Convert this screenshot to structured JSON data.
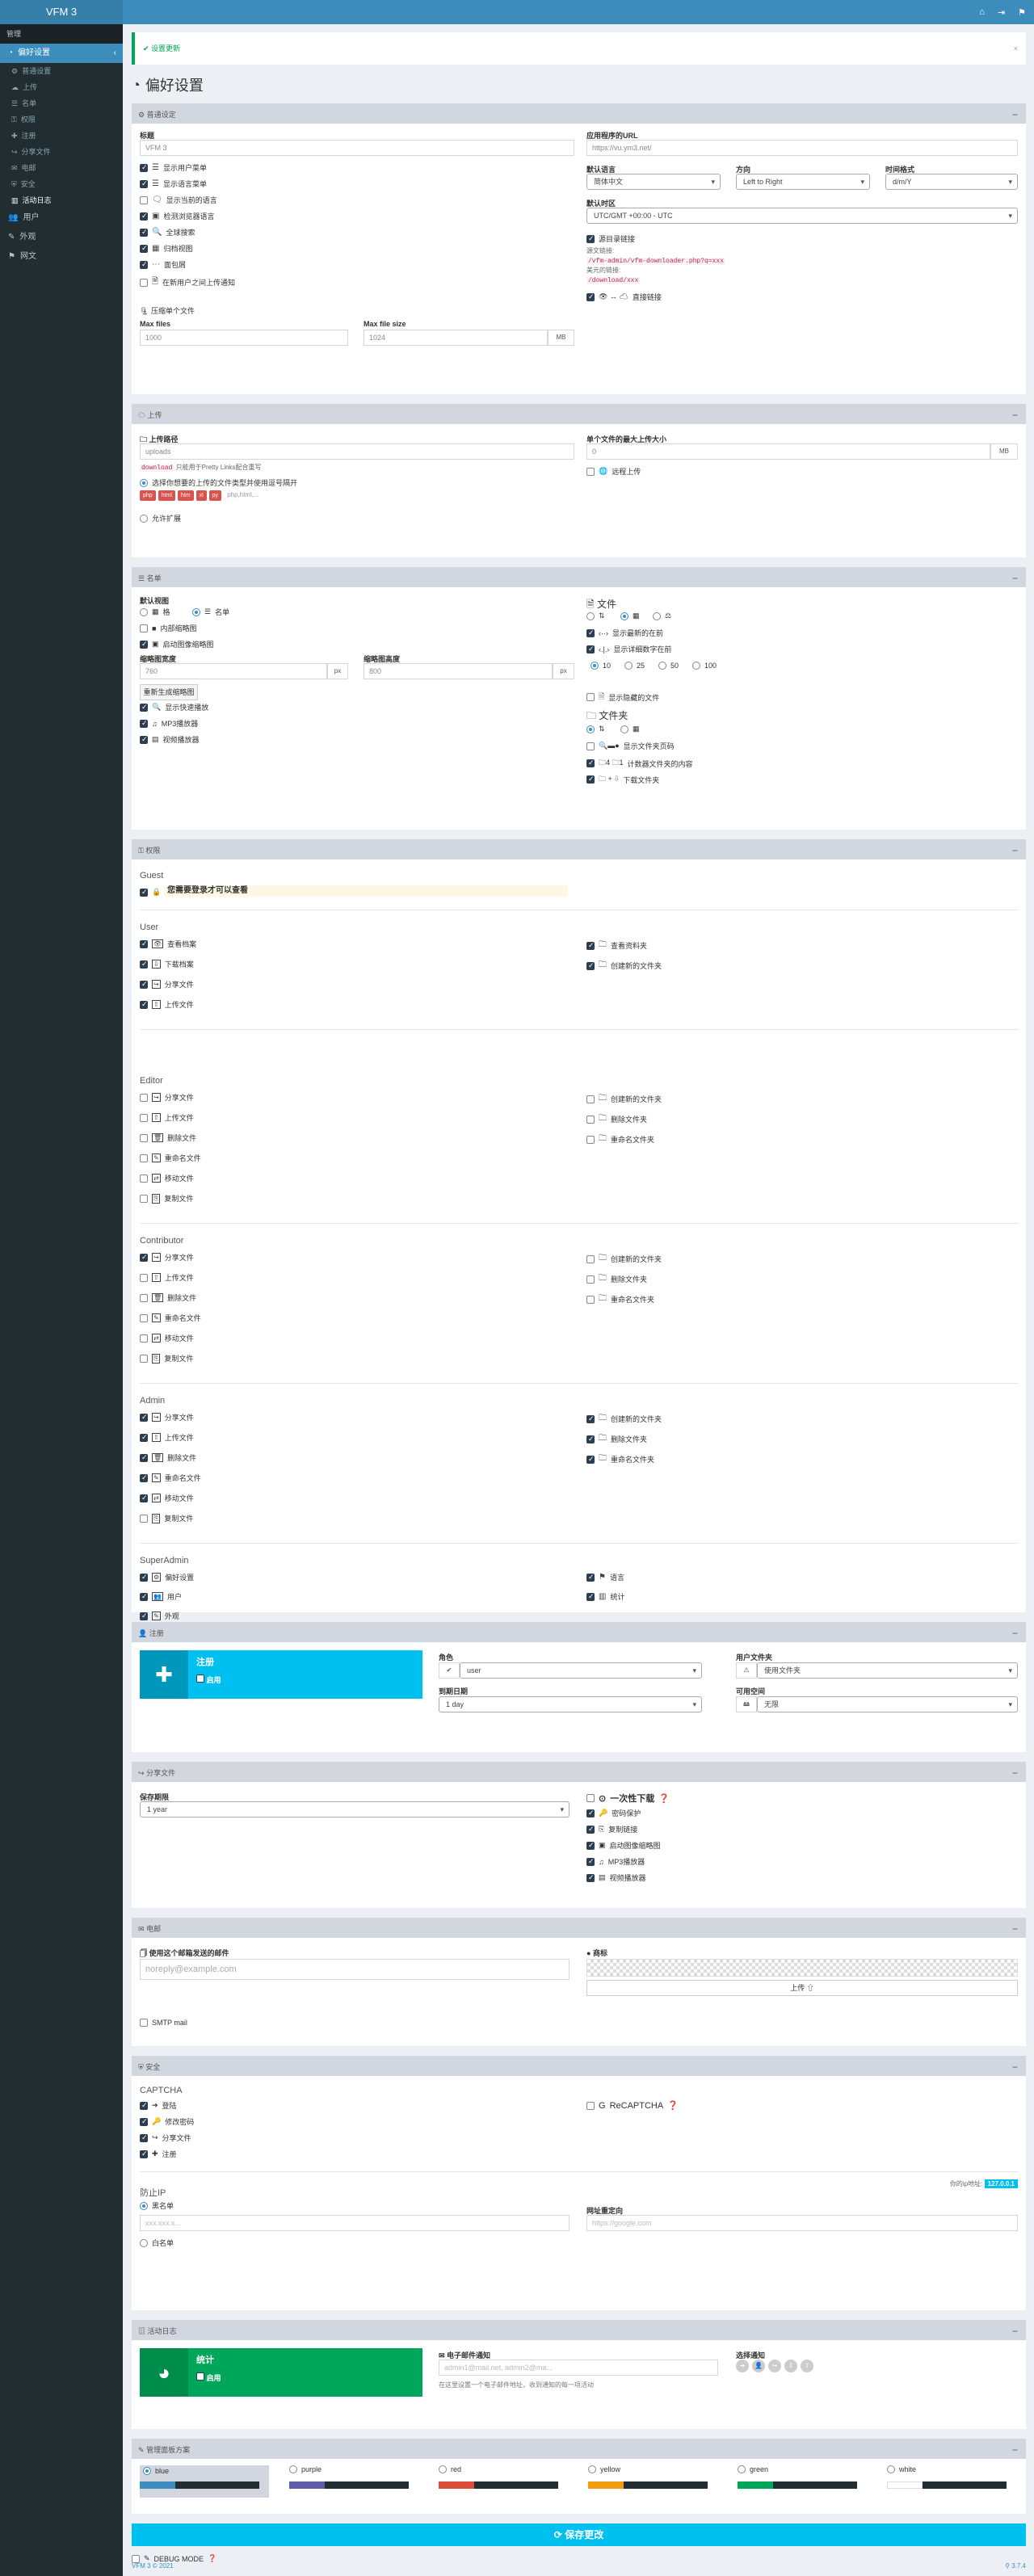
{
  "app": {
    "logo": "VFM 3",
    "footer": "VFM 3 © 2021",
    "version": "3.7.4",
    "topicons": [
      "⌂",
      "⇥",
      "⚑"
    ]
  },
  "sidebar": {
    "head": "管理",
    "active": "偏好设置",
    "subs": [
      "普通设置",
      "上传",
      "名单",
      "权限",
      "注册",
      "分享文件",
      "电邮",
      "安全",
      "活动日志"
    ],
    "items": [
      "用户",
      "外观",
      "网文"
    ]
  },
  "alert": "设置更新",
  "title": "偏好设置",
  "general": {
    "header": "普通设定",
    "title_label": "标题",
    "title_value": "VFM 3",
    "url_label": "应用程序的URL",
    "url_value": "https://vu.ym3.net/",
    "checks": [
      {
        "t": "显示用户菜单",
        "on": true
      },
      {
        "t": "显示语言菜单",
        "on": true
      },
      {
        "t": "显示当前的语言",
        "on": false
      },
      {
        "t": "检测浏览器语言",
        "on": true
      },
      {
        "t": "全球搜索",
        "on": true
      },
      {
        "t": "归档视图",
        "on": true
      },
      {
        "t": "面包屑",
        "on": true
      },
      {
        "t": "在新用户之间上传通知",
        "on": false
      }
    ],
    "single_file": "压缩单个文件",
    "max_files_label": "Max files",
    "max_files": "1000",
    "max_size_label": "Max file size",
    "max_size": "1024",
    "mb": "MB",
    "lang_label": "默认语言",
    "lang": "简体中文",
    "dir_label": "方向",
    "dir": "Left to Right",
    "time_label": "时间格式",
    "time": "d/m/Y",
    "tz_label": "默认时区",
    "tz": "UTC/GMT +00:00 - UTC",
    "direct_label": "源目录链接",
    "direct_on": true,
    "dl_text1": "源文链接:",
    "dl_code1": "/vfm-admin/vfm-downloader.php?q=xxx",
    "dl_text2": "美元的链接:",
    "dl_code2": "/download/xxx",
    "direct2": "直接链接"
  },
  "upload": {
    "header": "上传",
    "dir_label": "上传路径",
    "dir_value": "uploads",
    "prettylink_code": "download",
    "prettylink_text": "只能用于Pretty Links配合重写",
    "max_label": "单个文件的最大上传大小",
    "max_value": "0",
    "mb": "MB",
    "allowed": "选择你想要的上传的文件类型并使用逗号隔开",
    "types": [
      "php",
      "html",
      "htm",
      "xl",
      "py"
    ],
    "types_more": "php,html,...",
    "remote": "远程上传",
    "allow_ext": "允许扩展"
  },
  "lists": {
    "header": "名单",
    "view_label": "默认视图",
    "view_opts": [
      "格",
      "名单"
    ],
    "inline": "内部缩略图",
    "auto_thumb": "启动图像缩略图",
    "tw_label": "缩略图宽度",
    "tw": "760",
    "th_label": "缩略图高度",
    "th": "800",
    "px": "px",
    "regen": "重新生成缩略图",
    "checks": [
      "显示快速播放",
      "MP3播放器",
      "视频播放器"
    ],
    "files_h": "文件",
    "files_checks": [
      "显示最新的在前",
      "显示详细数字在前"
    ],
    "pages": [
      "10",
      "25",
      "50",
      "100"
    ],
    "hidden_files": "显示隐藏的文件",
    "folders_h": "文件夹",
    "folder_checks": [
      "显示文件夹页码",
      "计数器文件夹的内容",
      "下载文件夹"
    ]
  },
  "perm": {
    "header": "权限",
    "guest": "Guest",
    "guest_notice": "您需要登录才可以查看",
    "user": "User",
    "user_l": [
      "查看档案",
      "下载档案",
      "分享文件",
      "上传文件"
    ],
    "user_r": [
      "查看资料夹",
      "创建新的文件夹"
    ],
    "editor": "Editor",
    "editor_l": [
      "分享文件",
      "上传文件",
      "删除文件",
      "重命名文件",
      "移动文件",
      "复制文件"
    ],
    "editor_r": [
      "创建新的文件夹",
      "删除文件夹",
      "重命名文件夹"
    ],
    "contributor": "Contributor",
    "contrib_l": [
      "分享文件",
      "上传文件",
      "删除文件",
      "重命名文件",
      "移动文件",
      "复制文件"
    ],
    "contrib_r": [
      "创建新的文件夹",
      "删除文件夹",
      "重命名文件夹"
    ],
    "admin": "Admin",
    "admin_l": [
      "分享文件",
      "上传文件",
      "删除文件",
      "重命名文件",
      "移动文件",
      "复制文件"
    ],
    "admin_r": [
      "创建新的文件夹",
      "删除文件夹",
      "重命名文件夹"
    ],
    "superadmin": "SuperAdmin",
    "super_l": [
      "偏好设置",
      "用户",
      "外观"
    ],
    "super_r": [
      "语言",
      "统计"
    ]
  },
  "reg": {
    "header": "注册",
    "box_title": "注册",
    "box_sub": "启用",
    "role_label": "角色",
    "role": "user",
    "folder_label": "用户文件夹",
    "folder": "使用文件夹",
    "expire_label": "到期日期",
    "expire": "1 day",
    "quota_label": "可用空间",
    "quota": "无限"
  },
  "share": {
    "header": "分享文件",
    "lifetime_label": "保存期限",
    "lifetime": "1 year",
    "oneshot": "一次性下载",
    "checks": [
      "密码保护",
      "复制链接",
      "启动图像缩略图",
      "MP3播放器",
      "视频播放器"
    ]
  },
  "email": {
    "header": "电邮",
    "from_label": "使用这个邮箱发送的邮件",
    "from_ph": "noreply@example.com",
    "logo_label": "商标",
    "upload": "上传",
    "smtp": "SMTP mail"
  },
  "security": {
    "header": "安全",
    "captcha": "CAPTCHA",
    "cap_checks": [
      "登陆",
      "修改密码",
      "分享文件",
      "注册"
    ],
    "recaptcha": "ReCAPTCHA",
    "ip_label": "你的ip地址:",
    "ip": "127.0.0.1",
    "ip_h": "防止IP",
    "white": "黑名单",
    "black": "白名单",
    "ip_ph": "xxx.xxx.x...",
    "redir_label": "网址重定向",
    "redir_ph": "https://google.com"
  },
  "log": {
    "header": "活动日志",
    "box_title": "统计",
    "box_sub": "启用",
    "mail_label": "电子邮件通知",
    "mail_ph": "admin1@mail.net, admin2@ma...",
    "mail_help": "在这里设置一个电子邮件地址，收到通知的每一项活动",
    "select_label": "选择通知"
  },
  "appearance": {
    "header": "管理面板方案",
    "skins": [
      {
        "n": "blue",
        "c": "#3c8dbc",
        "on": true
      },
      {
        "n": "purple",
        "c": "#605ca8"
      },
      {
        "n": "red",
        "c": "#dd4b39"
      },
      {
        "n": "yellow",
        "c": "#f39c12"
      },
      {
        "n": "green",
        "c": "#00a65a"
      },
      {
        "n": "white",
        "c": "#ffffff"
      }
    ]
  },
  "save": "保存更改",
  "debug": "DEBUG MODE"
}
